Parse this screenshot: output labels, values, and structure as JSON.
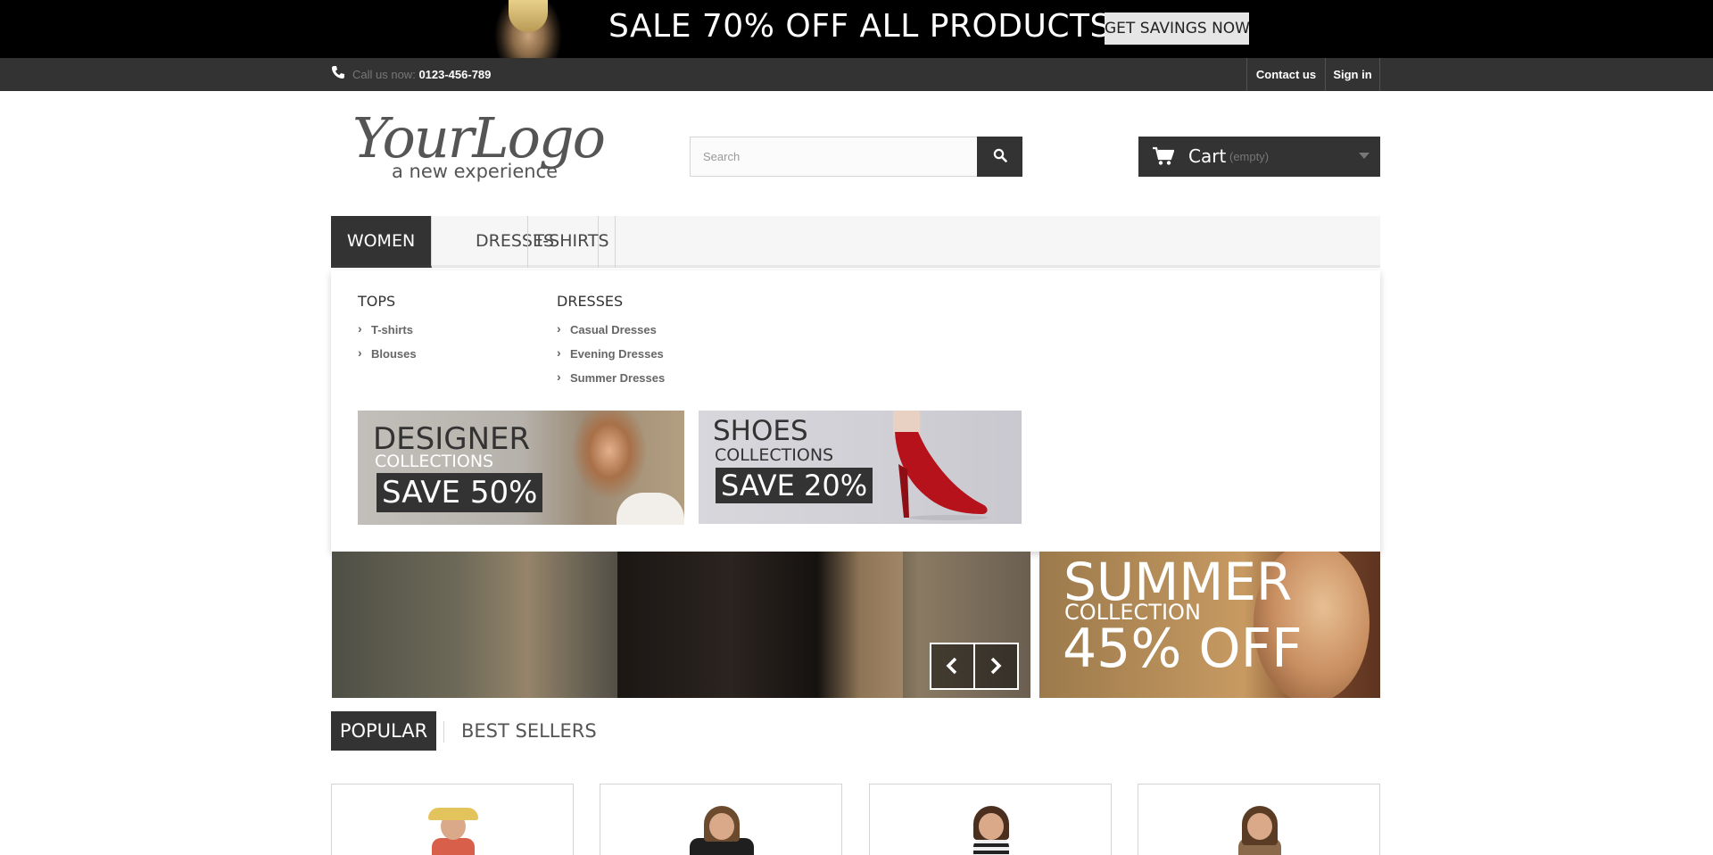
{
  "banner": {
    "headline": "SALE 70% OFF ALL PRODUCTS",
    "cta_label": "GET SAVINGS NOW"
  },
  "topnav": {
    "call_label": "Call us now:",
    "phone": "0123-456-789",
    "links": [
      "Contact us",
      "Sign in"
    ]
  },
  "header": {
    "logo_main": "YourLogo",
    "logo_tagline": "a new experience",
    "search_placeholder": "Search",
    "cart_label": "Cart",
    "cart_status": "(empty)"
  },
  "menu": {
    "items": [
      "WOMEN",
      "DRESSES",
      "T-SHIRTS"
    ],
    "active": "WOMEN",
    "dropdown": {
      "columns": [
        {
          "title": "TOPS",
          "links": [
            "T-shirts",
            "Blouses"
          ]
        },
        {
          "title": "DRESSES",
          "links": [
            "Casual Dresses",
            "Evening Dresses",
            "Summer Dresses"
          ]
        }
      ],
      "promos": [
        {
          "big": "DESIGNER",
          "small": "COLLECTIONS",
          "save": "SAVE 50%"
        },
        {
          "big": "SHOES",
          "small": "COLLECTIONS",
          "save": "SAVE 20%"
        }
      ]
    }
  },
  "slider_side": {
    "line1": "SUMMER",
    "line2": "COLLECTION",
    "line3": "45% OFF"
  },
  "tabs": [
    "POPULAR",
    "BEST SELLERS"
  ],
  "colors": {
    "dark": "#333333",
    "banner_bg": "#000000",
    "menu_bg": "#f6f6f6",
    "border": "#d6d4d4"
  }
}
